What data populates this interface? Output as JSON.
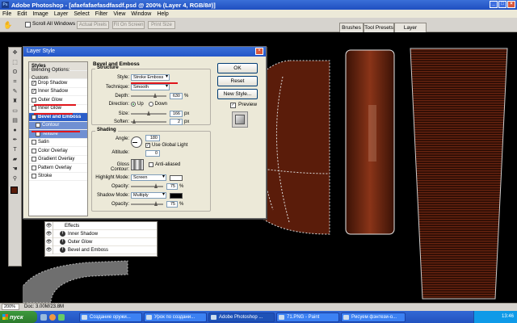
{
  "app": {
    "title": "Adobe Photoshop - [afaefafaefasdfasdf.psd @ 200% (Layer 4, RGB/8#)]"
  },
  "menu": [
    "File",
    "Edit",
    "Image",
    "Layer",
    "Select",
    "Filter",
    "View",
    "Window",
    "Help"
  ],
  "options": {
    "scroll_all": "Scroll All Windows",
    "actual_pixels": "Actual Pixels",
    "fit_on_screen": "Fit On Screen",
    "print_size": "Print Size",
    "tabs": [
      "Brushes",
      "Tool Presets",
      "Layer Comps"
    ]
  },
  "dialog": {
    "title": "Layer Style",
    "styles_header": "Styles",
    "blending": "Blending Options: Custom",
    "items": [
      {
        "label": "Drop Shadow",
        "checked": true
      },
      {
        "label": "Inner Shadow",
        "checked": true
      },
      {
        "label": "Outer Glow",
        "checked": false
      },
      {
        "label": "Inner Glow",
        "checked": false
      },
      {
        "label": "Bevel and Emboss",
        "checked": true
      },
      {
        "label": "Contour",
        "checked": false
      },
      {
        "label": "Texture",
        "checked": false
      },
      {
        "label": "Satin",
        "checked": false
      },
      {
        "label": "Color Overlay",
        "checked": false
      },
      {
        "label": "Gradient Overlay",
        "checked": false
      },
      {
        "label": "Pattern Overlay",
        "checked": false
      },
      {
        "label": "Stroke",
        "checked": false
      }
    ],
    "bevel_title": "Bevel and Emboss",
    "structure_title": "Structure",
    "style_label": "Style:",
    "style_value": "Stroke Emboss",
    "technique_label": "Technique:",
    "technique_value": "Smooth",
    "depth_label": "Depth:",
    "depth_value": "630",
    "depth_unit": "%",
    "direction_label": "Direction:",
    "dir_up": "Up",
    "dir_down": "Down",
    "size_label": "Size:",
    "size_value": "166",
    "size_unit": "px",
    "soften_label": "Soften:",
    "soften_value": "2",
    "soften_unit": "px",
    "shading_title": "Shading",
    "angle_label": "Angle:",
    "angle_value": "180",
    "use_global": "Use Global Light",
    "altitude_label": "Altitude:",
    "altitude_value": "0",
    "gloss_label": "Gloss Contour:",
    "anti_aliased": "Anti-aliased",
    "highlight_label": "Highlight Mode:",
    "highlight_value": "Screen",
    "opacity_label": "Opacity:",
    "highlight_opacity": "75",
    "shadow_label": "Shadow Mode:",
    "shadow_value": "Multiply",
    "shadow_opacity": "75",
    "percent": "%",
    "ok": "OK",
    "reset": "Reset",
    "new_style": "New Style...",
    "preview": "Preview"
  },
  "layers": [
    {
      "label": "Effects"
    },
    {
      "label": "Inner Shadow"
    },
    {
      "label": "Outer Glow"
    },
    {
      "label": "Bevel and Emboss"
    }
  ],
  "status": {
    "zoom": "200%",
    "doc": "Doc: 3.00M/23.8M"
  },
  "taskbar": {
    "start": "пуск",
    "tasks": [
      "Создание оружи...",
      "Урок по создани...",
      "Adobe Photoshop ...",
      "71.PNG - Paint",
      "Рисуем фэнтези-о..."
    ],
    "active_index": 2,
    "time": "13:46"
  },
  "colors": {
    "accent": "#2b5ec9",
    "marker": "#e0151b",
    "leather": "#7a2a12"
  }
}
